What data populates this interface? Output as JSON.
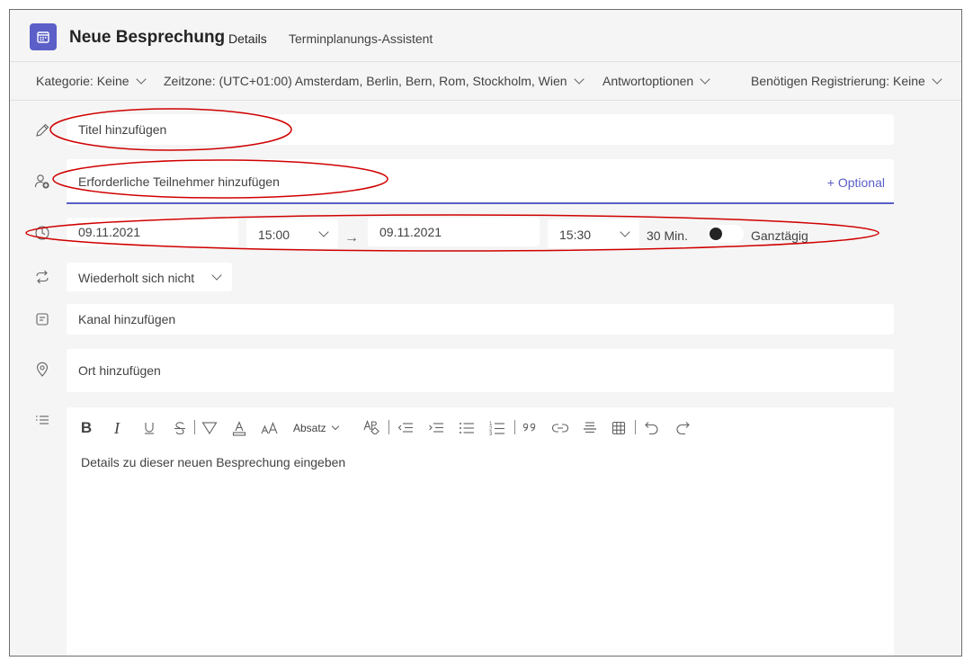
{
  "header": {
    "title": "Neue Besprechung",
    "tabs": [
      {
        "label": "Details",
        "active": true
      },
      {
        "label": "Terminplanungs-Assistent",
        "active": false
      }
    ],
    "app_icon": "calendar-icon"
  },
  "options_bar": {
    "category": "Kategorie: Keine",
    "timezone": "Zeitzone: (UTC+01:00) Amsterdam, Berlin, Bern, Rom, Stockholm, Wien",
    "response_options": "Antwortoptionen",
    "registration": "Benötigen Registrierung: Keine"
  },
  "form": {
    "title_placeholder": "Titel hinzufügen",
    "attendees_placeholder": "Erforderliche Teilnehmer hinzufügen",
    "optional_link": "+ Optional",
    "start_date": "09.11.2021",
    "start_time": "15:00",
    "end_date": "09.11.2021",
    "end_time": "15:30",
    "duration": "30 Min.",
    "all_day_label": "Ganztägig",
    "all_day_on": false,
    "repeat": "Wiederholt sich nicht",
    "channel_placeholder": "Kanal hinzufügen",
    "location_placeholder": "Ort hinzufügen"
  },
  "editor": {
    "paragraph_style": "Absatz",
    "placeholder": "Details zu dieser neuen Besprechung eingeben",
    "toolbar_icons": [
      "bold-icon",
      "italic-icon",
      "underline-icon",
      "strikethrough-icon",
      "highlight-icon",
      "font-color-icon",
      "font-size-icon",
      "paragraph-style-dropdown",
      "clear-format-icon",
      "decrease-indent-icon",
      "increase-indent-icon",
      "bulleted-list-icon",
      "numbered-list-icon",
      "quote-icon",
      "link-icon",
      "horizontal-rule-icon",
      "table-icon",
      "undo-icon",
      "redo-icon"
    ]
  },
  "colors": {
    "accent": "#5b5fc7",
    "annotation": "#d00000",
    "background": "#f5f5f5",
    "field": "#ffffff"
  }
}
